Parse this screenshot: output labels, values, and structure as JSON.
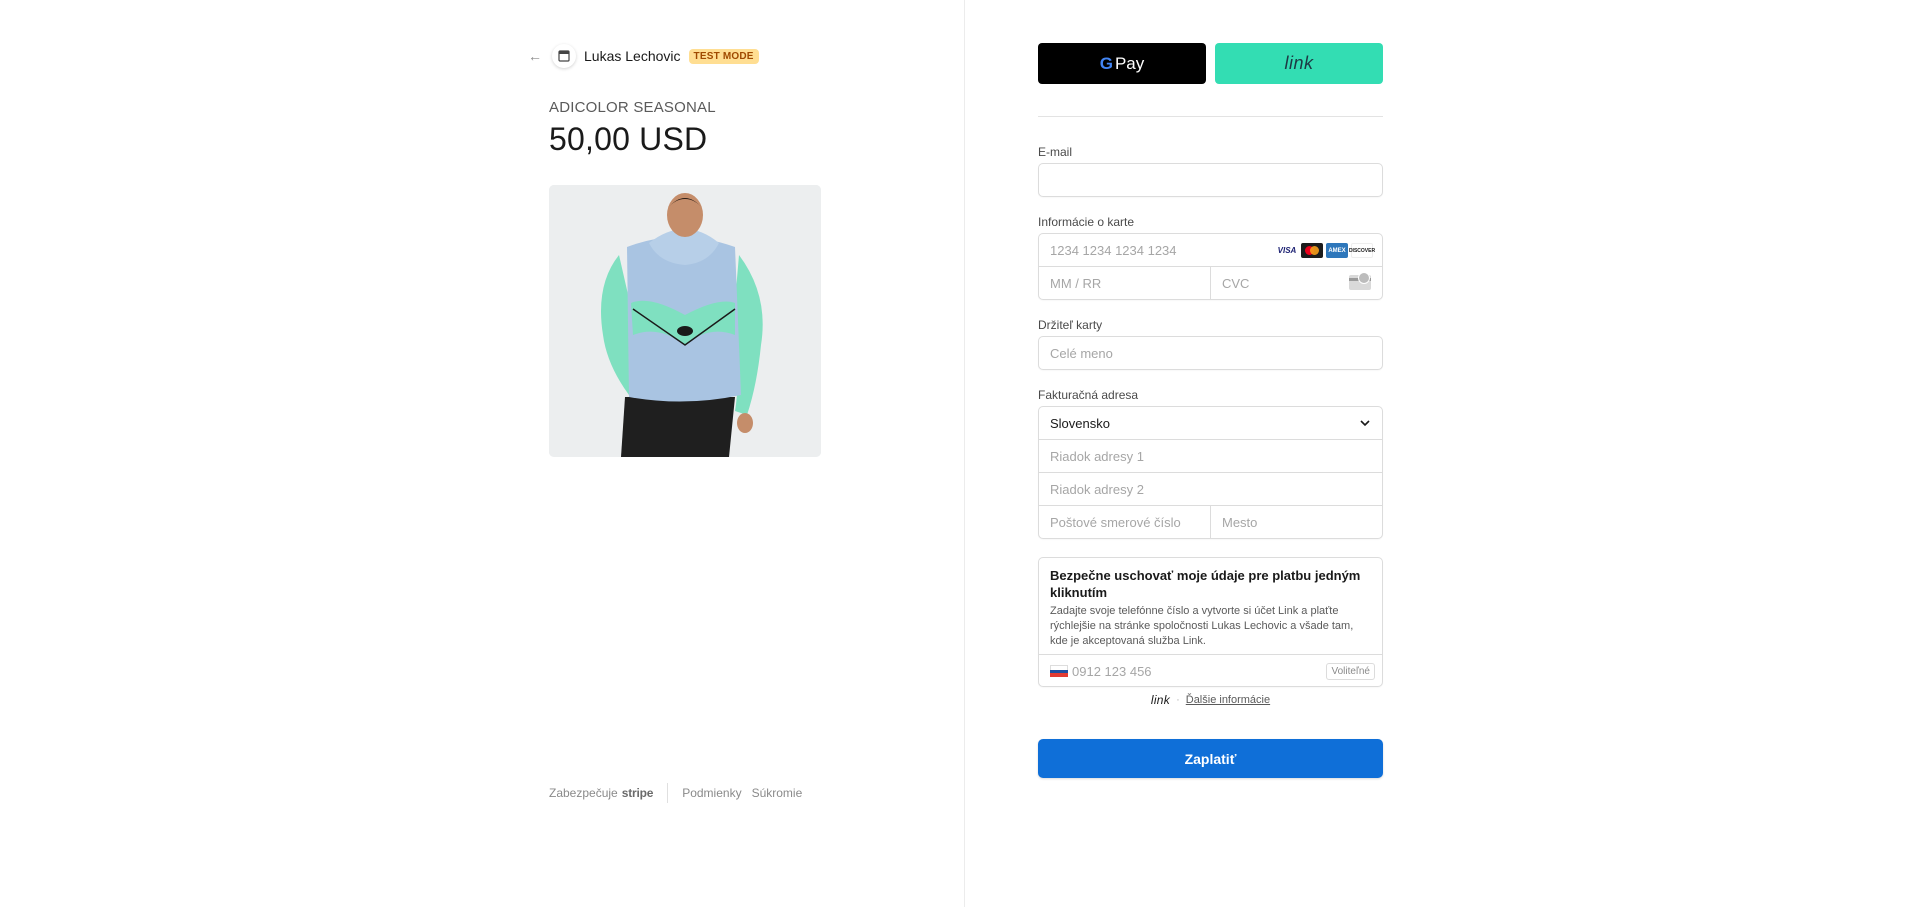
{
  "merchant": {
    "name": "Lukas Lechovic",
    "test_badge": "TEST MODE"
  },
  "product": {
    "name": "ADICOLOR SEASONAL",
    "price": "50,00 USD"
  },
  "footer": {
    "powered_by": "Zabezpečuje",
    "stripe": "stripe",
    "terms": "Podmienky",
    "privacy": "Súkromie"
  },
  "wallets": {
    "gpay_g": "G",
    "gpay_label": "Pay",
    "link_label": "link"
  },
  "form": {
    "email": {
      "label": "E-mail",
      "value": "",
      "placeholder": ""
    },
    "card": {
      "label": "Informácie o karte",
      "number_placeholder": "1234 1234 1234 1234",
      "expiry_placeholder": "MM / RR",
      "cvc_placeholder": "CVC",
      "brands": [
        "VISA",
        "",
        "AMEX",
        "DISCOVER"
      ]
    },
    "cardholder": {
      "label": "Držiteľ karty",
      "placeholder": "Celé meno"
    },
    "billing": {
      "label": "Fakturačná adresa",
      "country": "Slovensko",
      "line1_placeholder": "Riadok adresy 1",
      "line2_placeholder": "Riadok adresy 2",
      "zip_placeholder": "Poštové smerové číslo",
      "city_placeholder": "Mesto"
    }
  },
  "link_save": {
    "title": "Bezpečne uschovať moje údaje pre platbu jedným kliknutím",
    "description": "Zadajte svoje telefónne číslo a vytvorte si účet Link a plaťte rýchlejšie na stránke spoločnosti Lukas Lechovic a všade tam, kde je akceptovaná služba Link.",
    "phone_placeholder": "0912 123 456",
    "optional": "Voliteľné"
  },
  "link_info": {
    "logo": "link",
    "separator": "·",
    "more_info": "Ďalšie informácie"
  },
  "pay_button": "Zaplatiť",
  "colors": {
    "pay": "#0f6fd8",
    "link_green": "#33ddb3",
    "test_badge_bg": "#ffde92"
  }
}
